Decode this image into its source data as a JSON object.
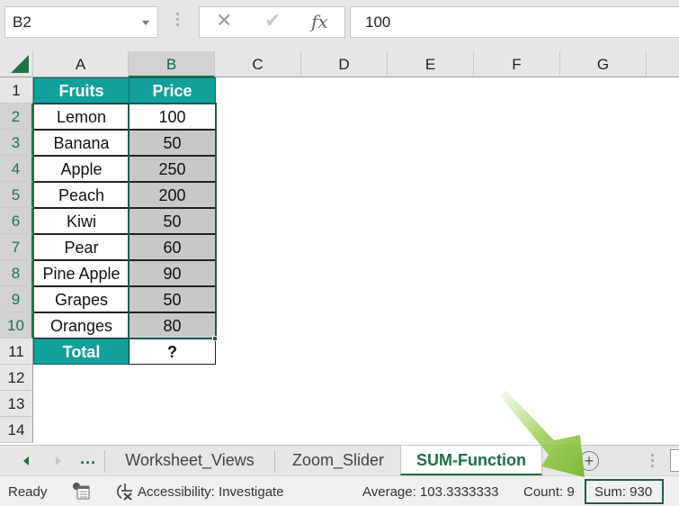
{
  "formula_bar": {
    "name_box": "B2",
    "cancel_icon": "✕",
    "enter_icon": "✔",
    "fx_label": "fx",
    "formula_value": "100"
  },
  "columns": [
    "A",
    "B",
    "C",
    "D",
    "E",
    "F",
    "G"
  ],
  "rows": [
    "1",
    "2",
    "3",
    "4",
    "5",
    "6",
    "7",
    "8",
    "9",
    "10",
    "11",
    "12",
    "13",
    "14"
  ],
  "table": {
    "headers": {
      "fruits": "Fruits",
      "price": "Price"
    },
    "items": [
      {
        "fruit": "Lemon",
        "price": "100"
      },
      {
        "fruit": "Banana",
        "price": "50"
      },
      {
        "fruit": "Apple",
        "price": "250"
      },
      {
        "fruit": "Peach",
        "price": "200"
      },
      {
        "fruit": "Kiwi",
        "price": "50"
      },
      {
        "fruit": "Pear",
        "price": "60"
      },
      {
        "fruit": "Pine Apple",
        "price": "90"
      },
      {
        "fruit": "Grapes",
        "price": "50"
      },
      {
        "fruit": "Oranges",
        "price": "80"
      }
    ],
    "total_label": "Total",
    "total_value": "?"
  },
  "sheet_tabs": {
    "more": "...",
    "tabs": [
      {
        "label": "Worksheet_Views",
        "active": false
      },
      {
        "label": "Zoom_Slider",
        "active": false
      },
      {
        "label": "SUM-Function",
        "active": true
      }
    ],
    "add_label": "+"
  },
  "status_bar": {
    "mode": "Ready",
    "accessibility": "Accessibility: Investigate",
    "average": "Average: 103.3333333",
    "count": "Count: 9",
    "sum": "Sum: 930"
  },
  "colors": {
    "header_teal": "#12a09a",
    "excel_green": "#217346",
    "selection_border": "#1c5a56",
    "selected_fill": "#c8c8c8",
    "arrow_green": "#8dc63f"
  }
}
